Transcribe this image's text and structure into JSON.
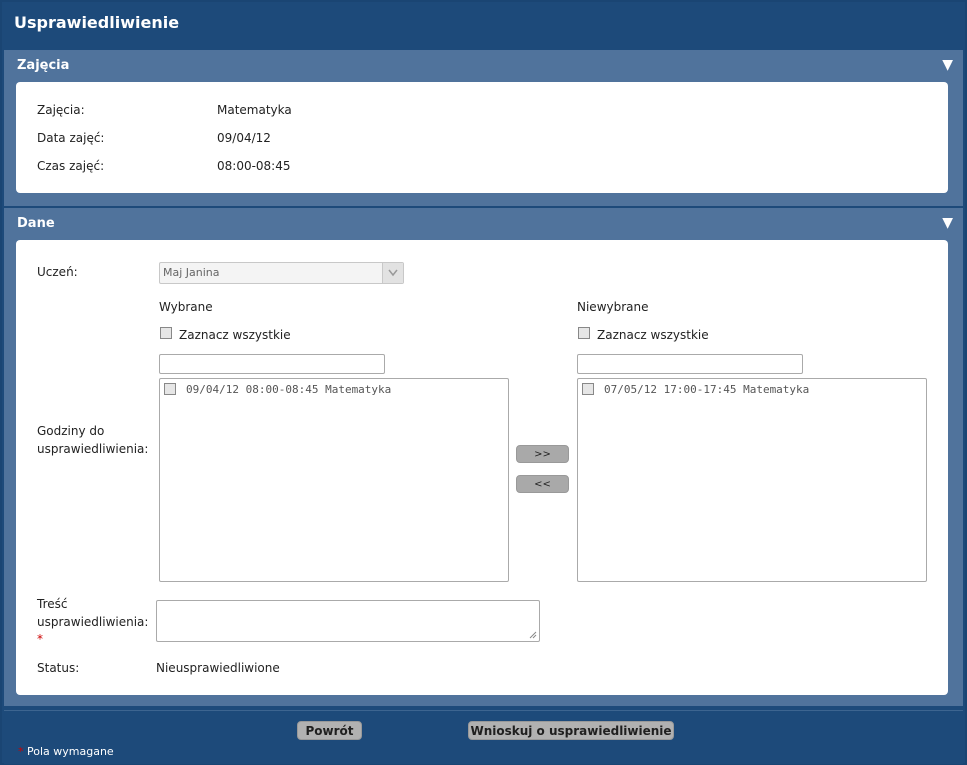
{
  "window": {
    "title": "Usprawiedliwienie"
  },
  "section_zajecia": {
    "header": "Zajęcia",
    "toggle_icon": "▼",
    "rows": [
      {
        "label": "Zajęcia:",
        "value": "Matematyka"
      },
      {
        "label": "Data zajęć:",
        "value": "09/04/12"
      },
      {
        "label": "Czas zajęć:",
        "value": "08:00-08:45"
      }
    ]
  },
  "section_dane": {
    "header": "Dane",
    "toggle_icon": "▼",
    "student": {
      "label": "Uczeń:",
      "selected": "Maj Janina"
    },
    "hours": {
      "label_line1": "Godziny do",
      "label_line2": "usprawiedliwienia:",
      "selected": {
        "title": "Wybrane",
        "select_all": "Zaznacz wszystkie",
        "filter_value": "",
        "items": [
          "09/04/12 08:00-08:45 Matematyka"
        ]
      },
      "unselected": {
        "title": "Niewybrane",
        "select_all": "Zaznacz wszystkie",
        "filter_value": "",
        "items": [
          "07/05/12 17:00-17:45 Matematyka"
        ]
      },
      "move_right": ">>",
      "move_left": "<<"
    },
    "content": {
      "label_line1": "Treść",
      "label_line2": "usprawiedliwienia:",
      "required_mark": "*",
      "value": ""
    },
    "status": {
      "label": "Status:",
      "value": "Nieusprawiedliwione"
    }
  },
  "footer": {
    "back_label": "Powrót",
    "submit_label": "Wnioskuj o usprawiedliwienie",
    "required_mark": "*",
    "required_note": "Pola wymagane"
  },
  "colors": {
    "header_dark": "#1d4a7a",
    "section_header": "#50739c",
    "required": "#cc0000",
    "button": "#b1b1b1"
  }
}
